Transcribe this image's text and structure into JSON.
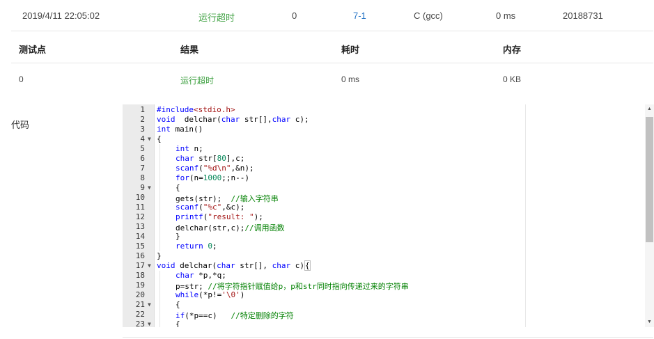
{
  "submission": {
    "time": "2019/4/11 22:05:02",
    "status": "运行超时",
    "score": "0",
    "problem": "7-1",
    "compiler": "C (gcc)",
    "elapsed": "0 ms",
    "user": "20188731"
  },
  "testpoint_table": {
    "headers": [
      "测试点",
      "结果",
      "耗时",
      "内存"
    ],
    "rows": [
      {
        "id": "0",
        "result": "运行超时",
        "time": "0 ms",
        "memory": "0 KB"
      }
    ]
  },
  "code_label": "代码",
  "code_lines": [
    {
      "n": "1",
      "fold": false,
      "indent": 0,
      "tokens": [
        [
          "p",
          "#include"
        ],
        [
          "pp",
          "<stdio.h>"
        ]
      ]
    },
    {
      "n": "2",
      "fold": false,
      "indent": 0,
      "tokens": [
        [
          "k",
          "void"
        ],
        [
          "",
          "  delchar("
        ],
        [
          "t",
          "char"
        ],
        [
          "",
          " str[],"
        ],
        [
          "t",
          "char"
        ],
        [
          "",
          " c);"
        ]
      ]
    },
    {
      "n": "3",
      "fold": false,
      "indent": 0,
      "tokens": [
        [
          "t",
          "int"
        ],
        [
          "",
          " main()"
        ]
      ]
    },
    {
      "n": "4",
      "fold": true,
      "indent": 0,
      "tokens": [
        [
          "",
          "{"
        ]
      ]
    },
    {
      "n": "5",
      "fold": false,
      "indent": 1,
      "tokens": [
        [
          "t",
          "int"
        ],
        [
          "",
          " n;"
        ]
      ]
    },
    {
      "n": "6",
      "fold": false,
      "indent": 1,
      "tokens": [
        [
          "t",
          "char"
        ],
        [
          "",
          " str["
        ],
        [
          "n",
          "80"
        ],
        [
          "",
          "],c;"
        ]
      ]
    },
    {
      "n": "7",
      "fold": false,
      "indent": 1,
      "tokens": [
        [
          "k",
          "scanf"
        ],
        [
          "",
          "("
        ],
        [
          "s",
          "\"%d\\n\""
        ],
        [
          "",
          ",&n);"
        ]
      ]
    },
    {
      "n": "8",
      "fold": false,
      "indent": 1,
      "tokens": [
        [
          "k",
          "for"
        ],
        [
          "",
          "(n="
        ],
        [
          "n",
          "1000"
        ],
        [
          "",
          ";;n--)"
        ]
      ]
    },
    {
      "n": "9",
      "fold": true,
      "indent": 1,
      "tokens": [
        [
          "",
          "{"
        ]
      ]
    },
    {
      "n": "10",
      "fold": false,
      "indent": 1,
      "tokens": [
        [
          "",
          "gets(str);  "
        ],
        [
          "c",
          "//输入字符串"
        ]
      ]
    },
    {
      "n": "11",
      "fold": false,
      "indent": 1,
      "tokens": [
        [
          "k",
          "scanf"
        ],
        [
          "",
          "("
        ],
        [
          "s",
          "\"%c\""
        ],
        [
          "",
          ",&c);"
        ]
      ]
    },
    {
      "n": "12",
      "fold": false,
      "indent": 1,
      "tokens": [
        [
          "k",
          "printf"
        ],
        [
          "",
          "("
        ],
        [
          "s",
          "\"result: \""
        ],
        [
          "",
          ");"
        ]
      ]
    },
    {
      "n": "13",
      "fold": false,
      "indent": 1,
      "tokens": [
        [
          "",
          "delchar(str,c);"
        ],
        [
          "c",
          "//调用函数"
        ]
      ]
    },
    {
      "n": "14",
      "fold": false,
      "indent": 1,
      "tokens": [
        [
          "",
          "}"
        ]
      ]
    },
    {
      "n": "15",
      "fold": false,
      "indent": 1,
      "tokens": [
        [
          "k",
          "return"
        ],
        [
          "",
          " "
        ],
        [
          "n",
          "0"
        ],
        [
          "",
          ";"
        ]
      ]
    },
    {
      "n": "16",
      "fold": false,
      "indent": 0,
      "tokens": [
        [
          "",
          "}"
        ]
      ]
    },
    {
      "n": "17",
      "fold": true,
      "indent": 0,
      "tokens": [
        [
          "k",
          "void"
        ],
        [
          "",
          " delchar("
        ],
        [
          "t",
          "char"
        ],
        [
          "",
          " str[], "
        ],
        [
          "t",
          "char"
        ],
        [
          "",
          " c)"
        ],
        [
          "cursor",
          "{"
        ]
      ]
    },
    {
      "n": "18",
      "fold": false,
      "indent": 1,
      "tokens": [
        [
          "t",
          "char"
        ],
        [
          "",
          " *p,*q;"
        ]
      ]
    },
    {
      "n": "19",
      "fold": false,
      "indent": 1,
      "tokens": [
        [
          "",
          "p=str; "
        ],
        [
          "c",
          "//将字符指针赋值给p，p和str同时指向传递过来的字符串"
        ]
      ]
    },
    {
      "n": "20",
      "fold": false,
      "indent": 1,
      "tokens": [
        [
          "k",
          "while"
        ],
        [
          "",
          "(*p!="
        ],
        [
          "s",
          "'\\0'"
        ],
        [
          "",
          ")"
        ]
      ]
    },
    {
      "n": "21",
      "fold": true,
      "indent": 1,
      "tokens": [
        [
          "",
          "{"
        ]
      ]
    },
    {
      "n": "22",
      "fold": false,
      "indent": 1,
      "tokens": [
        [
          "k",
          "if"
        ],
        [
          "",
          "(*p==c)   "
        ],
        [
          "c",
          "//特定删除的字符"
        ]
      ]
    },
    {
      "n": "23",
      "fold": true,
      "indent": 1,
      "tokens": [
        [
          "",
          "{"
        ]
      ]
    }
  ],
  "icons": {
    "fold": "fold-arrow-icon",
    "scroll_up": "scroll-up-arrow-icon",
    "scroll_down": "scroll-down-arrow-icon"
  },
  "colors": {
    "status_tle": "#3fa142",
    "problem_link": "#1e6fc3",
    "gutter_bg": "#ebebeb"
  }
}
